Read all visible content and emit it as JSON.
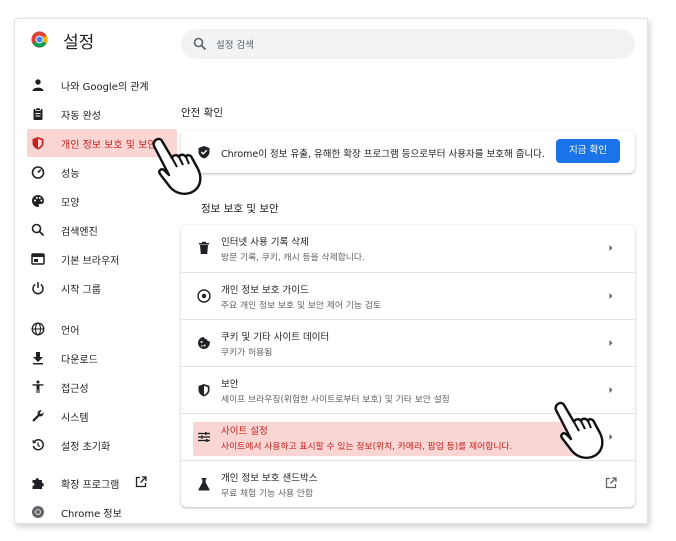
{
  "app": {
    "title": "설정"
  },
  "search": {
    "placeholder": "설정 검색"
  },
  "sidebar": {
    "items": [
      {
        "label": "나와 Google의 관계",
        "icon": "person-icon"
      },
      {
        "label": "자동 완성",
        "icon": "clipboard-icon"
      },
      {
        "label": "개인 정보 보호 및 보안",
        "icon": "shield-icon",
        "active": true
      },
      {
        "label": "성능",
        "icon": "speedometer-icon"
      },
      {
        "label": "모양",
        "icon": "palette-icon"
      },
      {
        "label": "검색엔진",
        "icon": "search-icon"
      },
      {
        "label": "기본 브라우저",
        "icon": "browser-icon"
      },
      {
        "label": "시작 그룹",
        "icon": "power-icon"
      },
      {
        "label": "언어",
        "icon": "globe-icon"
      },
      {
        "label": "다운로드",
        "icon": "download-icon"
      },
      {
        "label": "접근성",
        "icon": "accessibility-icon"
      },
      {
        "label": "시스템",
        "icon": "wrench-icon"
      },
      {
        "label": "설정 초기화",
        "icon": "restore-icon"
      },
      {
        "label": "확장 프로그램",
        "icon": "puzzle-icon"
      },
      {
        "label": "Chrome 정보",
        "icon": "chrome-icon"
      }
    ]
  },
  "safety_check": {
    "title": "안전 확인",
    "text": "Chrome이 정보 유출, 유해한 확장 프로그램 등으로부터 사용자를 보호해 줍니다.",
    "button": "지금 확인"
  },
  "privacy": {
    "title": "정보 보호 및 보안",
    "rows": [
      {
        "title": "인터넷 사용 기록 삭제",
        "subtitle": "방문 기록, 쿠키, 캐시 등을 삭제합니다.",
        "icon": "trash-icon"
      },
      {
        "title": "개인 정보 보호 가이드",
        "subtitle": "주요 개인 정보 보호 및 보안 제어 기능 검토",
        "icon": "compass-icon"
      },
      {
        "title": "쿠키 및 기타 사이트 데이터",
        "subtitle": "쿠키가 허용됨",
        "icon": "cookie-icon"
      },
      {
        "title": "보안",
        "subtitle": "세이프 브라우징(위험한 사이트로부터 보호) 및 기타 보안 설정",
        "icon": "shield-icon"
      },
      {
        "title": "사이트 설정",
        "subtitle": "사이트에서 사용하고 표시할 수 있는 정보(위치, 카메라, 팝업 등)를 제어합니다.",
        "icon": "sliders-icon",
        "highlighted": true
      },
      {
        "title": "개인 정보 보호 샌드박스",
        "subtitle": "무료 체험 기능 사용 안함",
        "icon": "flask-icon"
      }
    ]
  },
  "colors": {
    "accent": "#1a73e8",
    "highlight": "#f9d5d3",
    "active_text": "#c5221f"
  }
}
